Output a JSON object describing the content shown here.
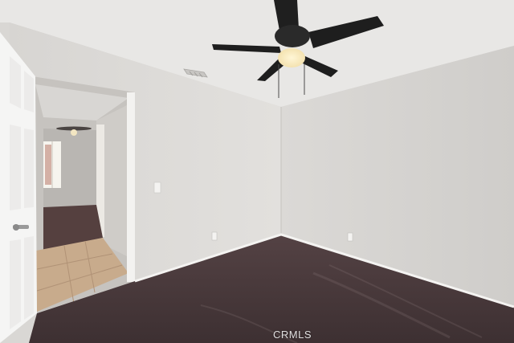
{
  "photo": {
    "watermark_text": "CRMLS",
    "palette": {
      "ceiling": "#e9e8e6",
      "wall_left": "#dcdad7",
      "wall_right": "#d5d3d0",
      "carpet": "#4a3a3b",
      "tile": "#c9ad8f",
      "trim": "#f3f3f1",
      "fan_blade": "#1e1e1e"
    },
    "visible_objects": [
      "ceiling-fan",
      "light-fixture",
      "air-vent",
      "open-door",
      "hallway",
      "hall-window",
      "light-switch",
      "outlet",
      "carpet-floor",
      "tile-floor",
      "baseboard"
    ]
  }
}
